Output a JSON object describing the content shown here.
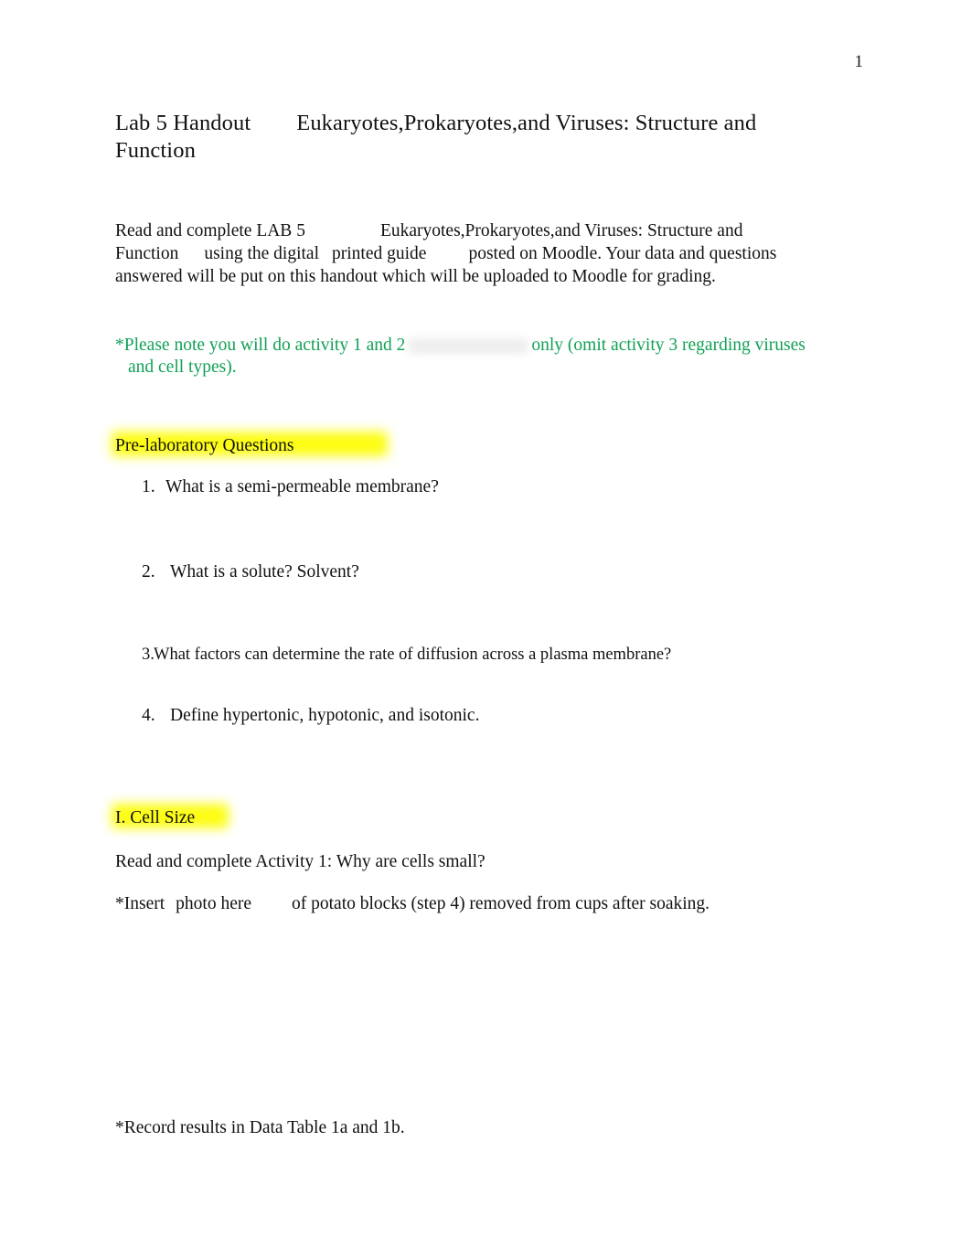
{
  "document": {
    "page_number": "1",
    "title": {
      "left": "Lab 5 Handout",
      "right": "Eukaryotes,Prokaryotes,and Viruses: Structure and Function"
    },
    "intro": {
      "seg1": "Read and complete LAB 5",
      "seg2": "Eukaryotes,Prokaryotes,and Viruses: Structure and Function",
      "seg3": "using the digital",
      "seg4": "printed guide",
      "seg5": "posted on Moodle. Your data and questions answered will be put on this handout which will be uploaded to Moodle for grading."
    },
    "note": {
      "part1": "*Please note you will do activity 1 and 2",
      "part2": "only (omit activity 3 regarding viruses",
      "part3": "and cell types)."
    },
    "headings": {
      "prelab": "Pre-laboratory Questions",
      "cell_size": "I. Cell Size"
    },
    "questions": [
      {
        "number": "1.",
        "text": "What is a semi-permeable membrane?"
      },
      {
        "number": "2.",
        "text": "What is a solute? Solvent?"
      },
      {
        "number": "3.",
        "text": "What factors can determine the rate of diffusion across a plasma membrane?"
      },
      {
        "number": "4.",
        "text": "Define hypertonic, hypotonic, and isotonic."
      }
    ],
    "cell_size_section": {
      "activity_line": "Read and complete Activity 1: Why are cells small?",
      "insert_a": "*Insert",
      "insert_b": "photo here",
      "insert_c": "of potato blocks (step 4) removed from cups after soaking.",
      "record_line": "*Record results in Data Table 1a and 1b."
    },
    "colors": {
      "note_green": "#11a055",
      "highlight_yellow": "#fdfd12",
      "text_black": "#111111",
      "page_background": "#ffffff"
    }
  }
}
